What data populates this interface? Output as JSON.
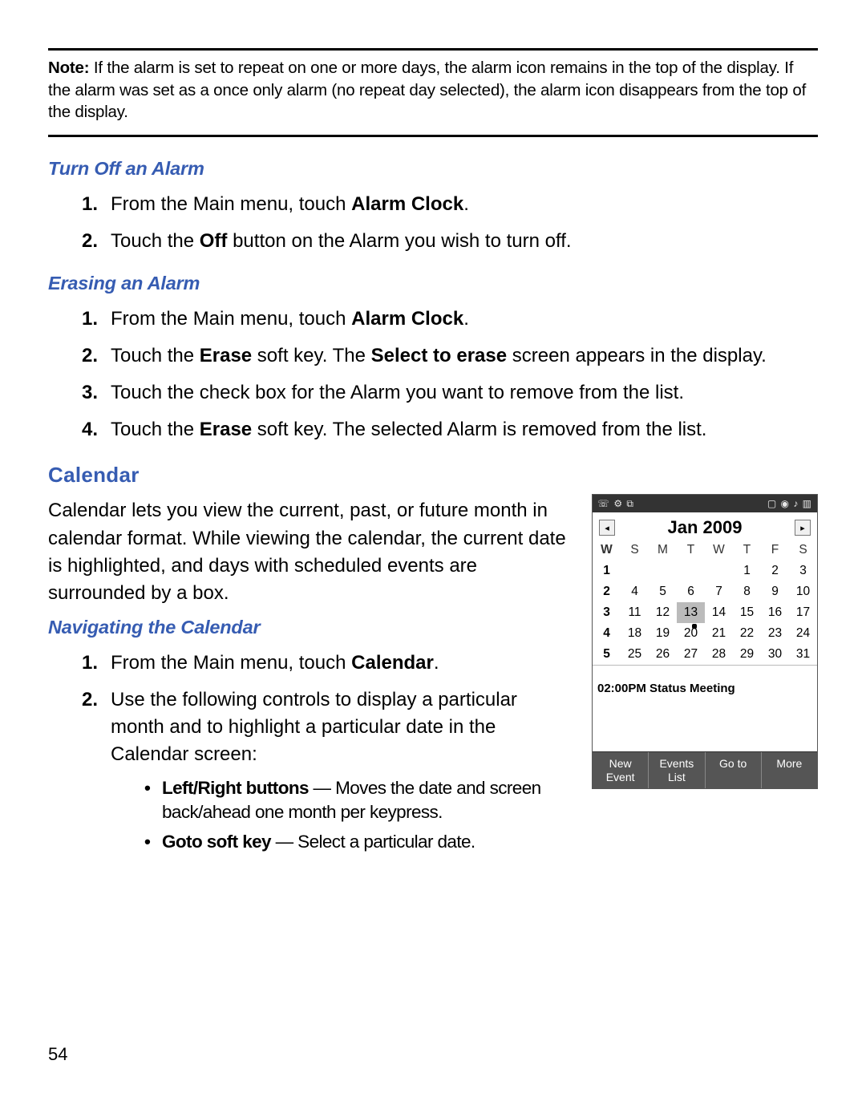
{
  "note": {
    "label": "Note:",
    "text": " If the alarm is set to repeat on one or more days, the alarm icon remains in the top of the display. If the alarm was set as a once only alarm (no repeat day selected), the alarm icon disappears from the top of the display."
  },
  "sections": {
    "turn_off_alarm": {
      "title": "Turn Off an Alarm",
      "steps": [
        {
          "pre": "From the Main menu, touch ",
          "bold": "Alarm Clock",
          "post": "."
        },
        {
          "pre": "Touch the ",
          "bold": "Off",
          "post": " button on the Alarm you wish to turn off."
        }
      ]
    },
    "erasing_alarm": {
      "title": "Erasing an Alarm",
      "steps": [
        {
          "pre": "From the Main menu, touch ",
          "bold": "Alarm Clock",
          "post": "."
        },
        {
          "pre": "Touch the ",
          "bold": "Erase",
          "post_pre": " soft key. The ",
          "bold2": "Select to erase",
          "post": " screen appears in the display."
        },
        {
          "pre": "Touch the check box for the Alarm you want to remove from the list."
        },
        {
          "pre": "Touch the ",
          "bold": "Erase",
          "post": " soft key. The selected Alarm is removed from the list."
        }
      ]
    },
    "calendar": {
      "title": "Calendar",
      "para": "Calendar lets you view the current, past, or future month in calendar format. While viewing the calendar, the current date is highlighted, and days with scheduled events are surrounded by a box."
    },
    "nav_cal": {
      "title": "Navigating the Calendar",
      "steps": [
        {
          "pre": "From the Main menu, touch ",
          "bold": "Calendar",
          "post": "."
        },
        {
          "pre": "Use the following controls to display a particular month and to highlight a particular date in the Calendar screen:"
        }
      ],
      "bullets": [
        {
          "bold": "Left/Right buttons",
          "rest": " — Moves the date and screen back/ahead one month per keypress."
        },
        {
          "bold": "Goto soft key",
          "rest": " — Select a particular date."
        }
      ]
    }
  },
  "device": {
    "month_title": "Jan 2009",
    "status_left": "☏ ⚙ ⧉",
    "status_right": "▢ ◉ ♪ ▥",
    "arrow_left": "◂",
    "arrow_right": "▸",
    "headers": [
      "W",
      "S",
      "M",
      "T",
      "W",
      "T",
      "F",
      "S"
    ],
    "rows": [
      [
        "1",
        "",
        "",
        "",
        "",
        "1",
        "2",
        "3"
      ],
      [
        "2",
        "4",
        "5",
        "6",
        "7",
        "8",
        "9",
        "10"
      ],
      [
        "3",
        "11",
        "12",
        "13",
        "14",
        "15",
        "16",
        "17"
      ],
      [
        "4",
        "18",
        "19",
        "20",
        "21",
        "22",
        "23",
        "24"
      ],
      [
        "5",
        "25",
        "26",
        "27",
        "28",
        "29",
        "30",
        "31"
      ]
    ],
    "highlight_cell": "13",
    "current_cell": "20",
    "event_text": "02:00PM Status Meeting",
    "soft_keys": [
      "New\nEvent",
      "Events\nList",
      "Go to",
      "More"
    ]
  },
  "page_number": "54"
}
